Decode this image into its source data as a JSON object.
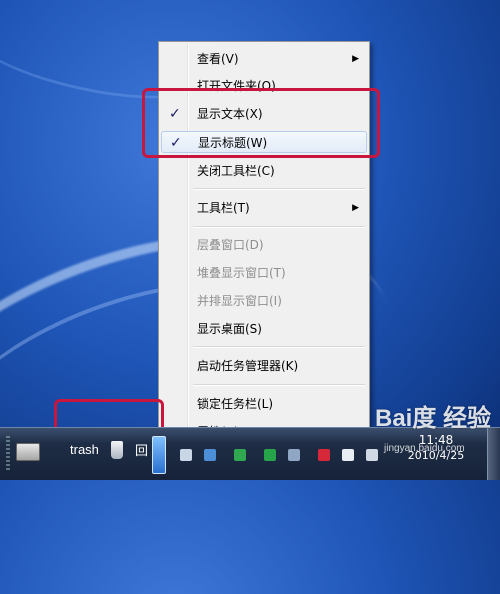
{
  "context_menu": {
    "items": [
      {
        "label": "查看(V)",
        "submenu": true,
        "checked": false,
        "disabled": false
      },
      {
        "label": "打开文件夹(O)",
        "submenu": false,
        "checked": false,
        "disabled": false
      },
      {
        "label": "显示文本(X)",
        "submenu": false,
        "checked": true,
        "disabled": false
      },
      {
        "label": "显示标题(W)",
        "submenu": false,
        "checked": true,
        "disabled": false
      },
      {
        "label": "关闭工具栏(C)",
        "submenu": false,
        "checked": false,
        "disabled": false
      },
      {
        "label": "工具栏(T)",
        "submenu": true,
        "checked": false,
        "disabled": false
      },
      {
        "label": "层叠窗口(D)",
        "submenu": false,
        "checked": false,
        "disabled": true
      },
      {
        "label": "堆叠显示窗口(T)",
        "submenu": false,
        "checked": false,
        "disabled": true
      },
      {
        "label": "并排显示窗口(I)",
        "submenu": false,
        "checked": false,
        "disabled": true
      },
      {
        "label": "显示桌面(S)",
        "submenu": false,
        "checked": false,
        "disabled": false
      },
      {
        "label": "启动任务管理器(K)",
        "submenu": false,
        "checked": false,
        "disabled": false
      },
      {
        "label": "锁定任务栏(L)",
        "submenu": false,
        "checked": false,
        "disabled": false
      },
      {
        "label": "属性(R)",
        "submenu": false,
        "checked": false,
        "disabled": false
      }
    ],
    "check_glyph": "✓",
    "submenu_glyph": "▶"
  },
  "taskbar": {
    "toolbar_label": "trash",
    "toolbar_label_extra": "回",
    "clock_time": "11:48",
    "clock_date": "2010/4/25"
  },
  "watermark": {
    "brand": "Bai度 经验",
    "url": "jingyan.baidu.com"
  },
  "colors": {
    "annotation": "#c8163e",
    "menu_bg": "#f0f0f0",
    "desktop": "#1f56b8"
  }
}
